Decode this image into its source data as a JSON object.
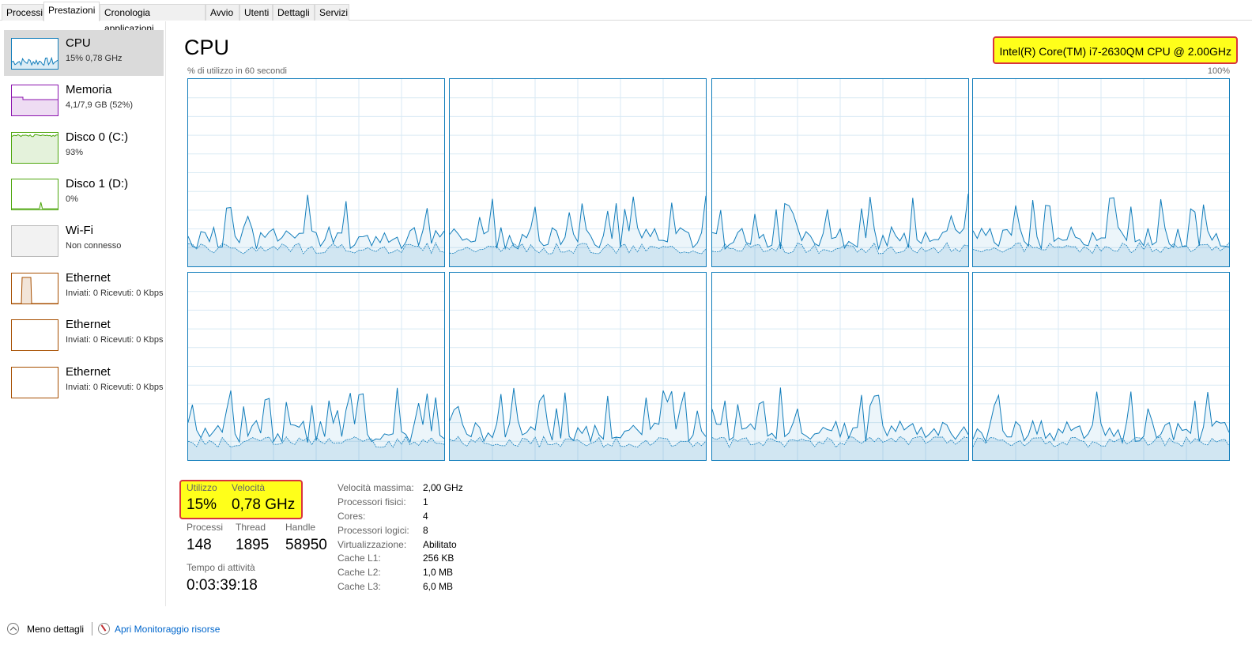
{
  "tabs": [
    {
      "label": "Processi",
      "active": false
    },
    {
      "label": "Prestazioni",
      "active": true
    },
    {
      "label": "Cronologia applicazioni",
      "active": false
    },
    {
      "label": "Avvio",
      "active": false
    },
    {
      "label": "Utenti",
      "active": false
    },
    {
      "label": "Dettagli",
      "active": false
    },
    {
      "label": "Servizi",
      "active": false
    }
  ],
  "sidebar": {
    "items": [
      {
        "title": "CPU",
        "subtitle": "15% 0,78 GHz",
        "color": "#117dbb",
        "selected": true
      },
      {
        "title": "Memoria",
        "subtitle": "4,1/7,9 GB (52%)",
        "color": "#8b12ae",
        "selected": false
      },
      {
        "title": "Disco 0 (C:)",
        "subtitle": "93%",
        "color": "#4da60c",
        "selected": false
      },
      {
        "title": "Disco 1 (D:)",
        "subtitle": "0%",
        "color": "#4da60c",
        "selected": false
      },
      {
        "title": "Wi-Fi",
        "subtitle": "Non connesso",
        "color": "#bbbbbb",
        "selected": false
      },
      {
        "title": "Ethernet",
        "subtitle": "Inviati: 0 Ricevuti: 0 Kbps",
        "color": "#a74f01",
        "selected": false
      },
      {
        "title": "Ethernet",
        "subtitle": "Inviati: 0 Ricevuti: 0 Kbps",
        "color": "#a74f01",
        "selected": false
      },
      {
        "title": "Ethernet",
        "subtitle": "Inviati: 0 Ricevuti: 0 Kbps",
        "color": "#a74f01",
        "selected": false
      }
    ]
  },
  "main": {
    "title": "CPU",
    "cpu_name": "Intel(R) Core(TM) i7-2630QM CPU @ 2.00GHz",
    "graph_caption": "% di utilizzo in 60 secondi",
    "graph_max": "100%",
    "graph_color": "#117dbb"
  },
  "stats": {
    "utilization_label": "Utilizzo",
    "utilization_value": "15%",
    "speed_label": "Velocità",
    "speed_value": "0,78 GHz",
    "processes_label": "Processi",
    "processes_value": "148",
    "threads_label": "Thread",
    "threads_value": "1895",
    "handles_label": "Handle",
    "handles_value": "58950",
    "uptime_label": "Tempo di attività",
    "uptime_value": "0:03:39:18"
  },
  "specs": [
    {
      "label": "Velocità massima:",
      "value": "2,00 GHz"
    },
    {
      "label": "Processori fisici:",
      "value": "1"
    },
    {
      "label": "Cores:",
      "value": "4"
    },
    {
      "label": "Processori logici:",
      "value": "8"
    },
    {
      "label": "Virtualizzazione:",
      "value": "Abilitato"
    },
    {
      "label": "Cache L1:",
      "value": "256 KB"
    },
    {
      "label": "Cache L2:",
      "value": "1,0 MB"
    },
    {
      "label": "Cache L3:",
      "value": "6,0 MB"
    }
  ],
  "footer": {
    "less_details": "Meno dettagli",
    "open_monitor": "Apri Monitoraggio risorse"
  }
}
